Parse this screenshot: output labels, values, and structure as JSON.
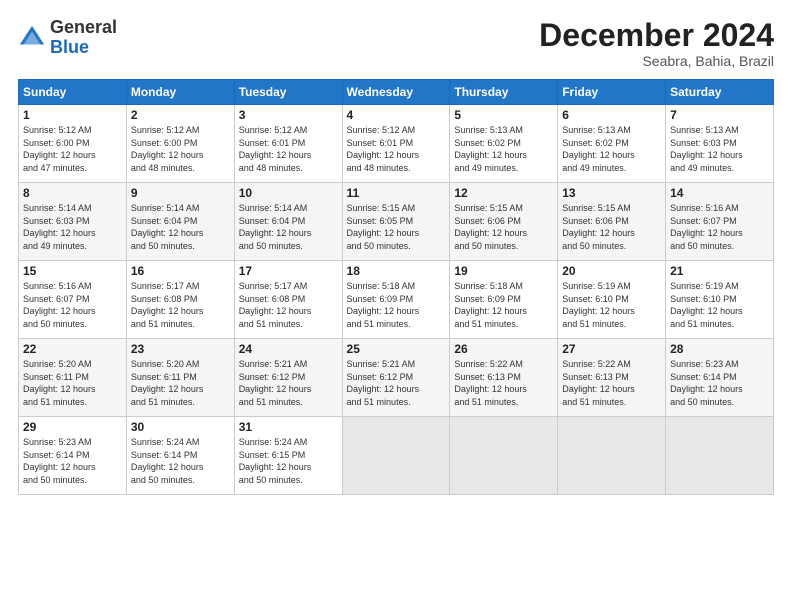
{
  "header": {
    "logo_general": "General",
    "logo_blue": "Blue",
    "month_title": "December 2024",
    "subtitle": "Seabra, Bahia, Brazil"
  },
  "days_of_week": [
    "Sunday",
    "Monday",
    "Tuesday",
    "Wednesday",
    "Thursday",
    "Friday",
    "Saturday"
  ],
  "weeks": [
    [
      {
        "day": "1",
        "info": "Sunrise: 5:12 AM\nSunset: 6:00 PM\nDaylight: 12 hours\nand 47 minutes."
      },
      {
        "day": "2",
        "info": "Sunrise: 5:12 AM\nSunset: 6:00 PM\nDaylight: 12 hours\nand 48 minutes."
      },
      {
        "day": "3",
        "info": "Sunrise: 5:12 AM\nSunset: 6:01 PM\nDaylight: 12 hours\nand 48 minutes."
      },
      {
        "day": "4",
        "info": "Sunrise: 5:12 AM\nSunset: 6:01 PM\nDaylight: 12 hours\nand 48 minutes."
      },
      {
        "day": "5",
        "info": "Sunrise: 5:13 AM\nSunset: 6:02 PM\nDaylight: 12 hours\nand 49 minutes."
      },
      {
        "day": "6",
        "info": "Sunrise: 5:13 AM\nSunset: 6:02 PM\nDaylight: 12 hours\nand 49 minutes."
      },
      {
        "day": "7",
        "info": "Sunrise: 5:13 AM\nSunset: 6:03 PM\nDaylight: 12 hours\nand 49 minutes."
      }
    ],
    [
      {
        "day": "8",
        "info": "Sunrise: 5:14 AM\nSunset: 6:03 PM\nDaylight: 12 hours\nand 49 minutes."
      },
      {
        "day": "9",
        "info": "Sunrise: 5:14 AM\nSunset: 6:04 PM\nDaylight: 12 hours\nand 50 minutes."
      },
      {
        "day": "10",
        "info": "Sunrise: 5:14 AM\nSunset: 6:04 PM\nDaylight: 12 hours\nand 50 minutes."
      },
      {
        "day": "11",
        "info": "Sunrise: 5:15 AM\nSunset: 6:05 PM\nDaylight: 12 hours\nand 50 minutes."
      },
      {
        "day": "12",
        "info": "Sunrise: 5:15 AM\nSunset: 6:06 PM\nDaylight: 12 hours\nand 50 minutes."
      },
      {
        "day": "13",
        "info": "Sunrise: 5:15 AM\nSunset: 6:06 PM\nDaylight: 12 hours\nand 50 minutes."
      },
      {
        "day": "14",
        "info": "Sunrise: 5:16 AM\nSunset: 6:07 PM\nDaylight: 12 hours\nand 50 minutes."
      }
    ],
    [
      {
        "day": "15",
        "info": "Sunrise: 5:16 AM\nSunset: 6:07 PM\nDaylight: 12 hours\nand 50 minutes."
      },
      {
        "day": "16",
        "info": "Sunrise: 5:17 AM\nSunset: 6:08 PM\nDaylight: 12 hours\nand 51 minutes."
      },
      {
        "day": "17",
        "info": "Sunrise: 5:17 AM\nSunset: 6:08 PM\nDaylight: 12 hours\nand 51 minutes."
      },
      {
        "day": "18",
        "info": "Sunrise: 5:18 AM\nSunset: 6:09 PM\nDaylight: 12 hours\nand 51 minutes."
      },
      {
        "day": "19",
        "info": "Sunrise: 5:18 AM\nSunset: 6:09 PM\nDaylight: 12 hours\nand 51 minutes."
      },
      {
        "day": "20",
        "info": "Sunrise: 5:19 AM\nSunset: 6:10 PM\nDaylight: 12 hours\nand 51 minutes."
      },
      {
        "day": "21",
        "info": "Sunrise: 5:19 AM\nSunset: 6:10 PM\nDaylight: 12 hours\nand 51 minutes."
      }
    ],
    [
      {
        "day": "22",
        "info": "Sunrise: 5:20 AM\nSunset: 6:11 PM\nDaylight: 12 hours\nand 51 minutes."
      },
      {
        "day": "23",
        "info": "Sunrise: 5:20 AM\nSunset: 6:11 PM\nDaylight: 12 hours\nand 51 minutes."
      },
      {
        "day": "24",
        "info": "Sunrise: 5:21 AM\nSunset: 6:12 PM\nDaylight: 12 hours\nand 51 minutes."
      },
      {
        "day": "25",
        "info": "Sunrise: 5:21 AM\nSunset: 6:12 PM\nDaylight: 12 hours\nand 51 minutes."
      },
      {
        "day": "26",
        "info": "Sunrise: 5:22 AM\nSunset: 6:13 PM\nDaylight: 12 hours\nand 51 minutes."
      },
      {
        "day": "27",
        "info": "Sunrise: 5:22 AM\nSunset: 6:13 PM\nDaylight: 12 hours\nand 51 minutes."
      },
      {
        "day": "28",
        "info": "Sunrise: 5:23 AM\nSunset: 6:14 PM\nDaylight: 12 hours\nand 50 minutes."
      }
    ],
    [
      {
        "day": "29",
        "info": "Sunrise: 5:23 AM\nSunset: 6:14 PM\nDaylight: 12 hours\nand 50 minutes."
      },
      {
        "day": "30",
        "info": "Sunrise: 5:24 AM\nSunset: 6:14 PM\nDaylight: 12 hours\nand 50 minutes."
      },
      {
        "day": "31",
        "info": "Sunrise: 5:24 AM\nSunset: 6:15 PM\nDaylight: 12 hours\nand 50 minutes."
      },
      {
        "day": "",
        "info": ""
      },
      {
        "day": "",
        "info": ""
      },
      {
        "day": "",
        "info": ""
      },
      {
        "day": "",
        "info": ""
      }
    ]
  ]
}
